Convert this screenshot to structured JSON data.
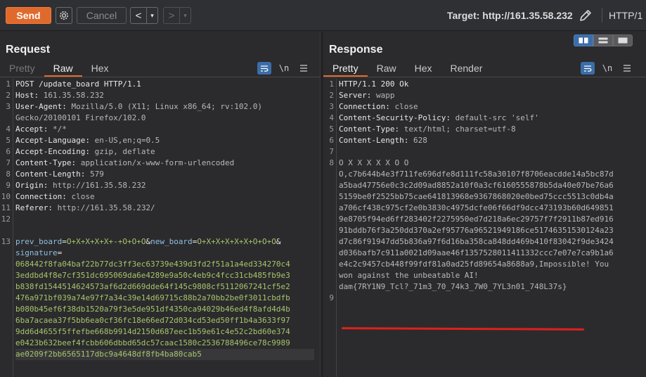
{
  "toolbar": {
    "send_label": "Send",
    "cancel_label": "Cancel",
    "back_arrow": "<",
    "forward_arrow": ">",
    "dropdown_glyph": "▾",
    "target_text": "Target: http://161.35.58.232",
    "protocol": "HTTP/1"
  },
  "request": {
    "title": "Request",
    "tabs": [
      "Pretty",
      "Raw",
      "Hex"
    ],
    "active_tab": "Raw",
    "newline_toggle": "\\n",
    "line_numbers": [
      "1",
      "2",
      "3",
      "",
      "4",
      "5",
      "6",
      "7",
      "8",
      "9",
      "10",
      "11",
      "12",
      "13"
    ],
    "lines": {
      "l1": "POST /update_board HTTP/1.1",
      "l2k": "Host",
      "l2v": " 161.35.58.232",
      "l3k": "User-Agent",
      "l3v": " Mozilla/5.0 (X11; Linux x86_64; rv:102.0)",
      "l3b": "Gecko/20100101 Firefox/102.0",
      "l4k": "Accept",
      "l4v": " */*",
      "l5k": "Accept-Language",
      "l5v": " en-US,en;q=0.5",
      "l6k": "Accept-Encoding",
      "l6v": " gzip, deflate",
      "l7k": "Content-Type",
      "l7v": " application/x-www-form-urlencoded",
      "l8k": "Content-Length",
      "l8v": " 579",
      "l9k": "Origin",
      "l9v": " http://161.35.58.232",
      "l10k": "Connection",
      "l10v": " close",
      "l11k": "Referer",
      "l11v": " http://161.35.58.232/",
      "p1k": "prev_board",
      "p1v": "O+X+X+X+X+-+O+O+O",
      "p2k": "new_board",
      "p2v": "O+X+X+X+X+X+O+O+O",
      "p3k": "signature",
      "sig": [
        "068442f8fa04baf22b77dc3ff3ec63739e439d3fd2f51a1a4ed334270c4",
        "3eddbd4f8e7cf351dc695069da6e4289e9a50c4eb9c4fcc31cb485fb9e3",
        "b838fd1544514624573af6d2d669dde64f145c9808cf5112067241cf5e2",
        "476a971bf039a74e97f7a34c39e14d69715c88b2a70bb2be0f3011cbdfb",
        "b080b45ef6f38db1520a79f3e5de951df4350ca94029b46ed4f8afd4d4b",
        "6ba7acaea37f5bb6ea0cf36fc18e66ed72d034cd53ed50ff1b4a3633f97",
        "9dd6d4655f5ffefbe668b9914d2150d687eec1b59e61c4e52c2bd60e374",
        "e0423b632beef4fcbb606dbbd65dc57caac1580c2536788496ce78c9989",
        "ae0209f2bb6565117dbc9a4648df8fb4ba80cab5"
      ]
    }
  },
  "response": {
    "title": "Response",
    "tabs": [
      "Pretty",
      "Raw",
      "Hex",
      "Render"
    ],
    "active_tab": "Pretty",
    "newline_toggle": "\\n",
    "line_numbers": [
      "1",
      "2",
      "3",
      "4",
      "5",
      "6",
      "7",
      "8",
      "9"
    ],
    "lines": {
      "l1": "HTTP/1.1 200 Ok",
      "l2k": "Server",
      "l2v": " wapp",
      "l3k": "Connection",
      "l3v": " close",
      "l4k": "Content-Security-Policy",
      "l4v": " default-src 'self'",
      "l5k": "Content-Type",
      "l5v": " text/html; charset=utf-8",
      "l6k": "Content-Length",
      "l6v": " 628",
      "body": [
        "O X X X X X O O",
        "O,c7b644b4e3f711fe696dfe8d111fc58a30107f8706eacdde14a5bc87d",
        "a5bad47756e0c3c2d09ad8852a10f0a3cf6160555878b5da40e07be76a6",
        "5159be0f2525bb75cae641813968e9367868020e0bed75ccc5513c0db4a",
        "a706cf438c975cf2e0b3830c4975dcfe06f66df9dcc473193b60d649851",
        "9e8705f94ed6ff283402f2275950ed7d218a6ec29757f7f2911b87ed916",
        "91bddb76f3a250dd370a2ef95776a96521949186ce51746351530124a23",
        "d7c86f91947dd5b836a97f6d16ba358ca848dd469b410f83042f9de3424",
        "d036bafb7c911a0021d09aae46f1357528011411332ccc7e07e7ca9b1a6",
        "e4c2c9457cb448f99fdf81a0ad25fd89654a8688a9,Impossible! You",
        "won against the unbeatable AI!",
        "dam{7RY1N9_Tcl?_71m3_70_74k3_7W0_7YL3n01_748L37s}"
      ]
    }
  },
  "colors": {
    "send": "#e06a2c",
    "tab_active_underline": "#e06a2c",
    "toggle_active": "#3b6ea8",
    "flag_underline": "#e0201c"
  },
  "icons": [
    "gear-icon",
    "pencil-icon",
    "wrap-lines-icon",
    "menu-icon",
    "layout-side-by-side-icon",
    "layout-stacked-icon",
    "layout-single-icon"
  ]
}
